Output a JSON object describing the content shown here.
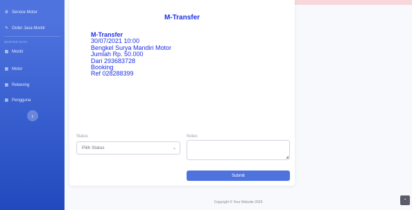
{
  "sidebar": {
    "items_top": [
      {
        "icon": "gear-icon",
        "glyph": "⚙",
        "label": "Service Motor"
      },
      {
        "icon": "wrench-icon",
        "glyph": "✎",
        "label": "Order Jasa Montir"
      }
    ],
    "heading": "MASTER DATA",
    "items_master": [
      {
        "icon": "table-icon",
        "glyph": "▦",
        "label": "Montir"
      },
      {
        "icon": "table-icon",
        "glyph": "▦",
        "label": "Motor"
      },
      {
        "icon": "table-icon",
        "glyph": "▦",
        "label": "Rekening"
      },
      {
        "icon": "table-icon",
        "glyph": "▦",
        "label": "Pengguna"
      }
    ],
    "toggle_glyph": "‹"
  },
  "card": {
    "title": "M-Transfer",
    "receipt": {
      "title": "M-Transfer",
      "lines": [
        "30/07/2021 10:00",
        "Bengkel Surya Mandiri Motor",
        "Jumlah Rp. 50.000",
        "Dari 293683728",
        "Booking",
        "Ref 028288399"
      ]
    },
    "status_label": "Status",
    "status_value": "Pilih Status",
    "notes_label": "Notes",
    "submit_label": "Submit"
  },
  "footer": {
    "text": "Copyright © Your Website 2020"
  },
  "scroll_top_glyph": "⌃",
  "colors": {
    "primary": "#4e73df",
    "receipt_text": "#1a2ee8",
    "alert": "#f8d7da"
  }
}
